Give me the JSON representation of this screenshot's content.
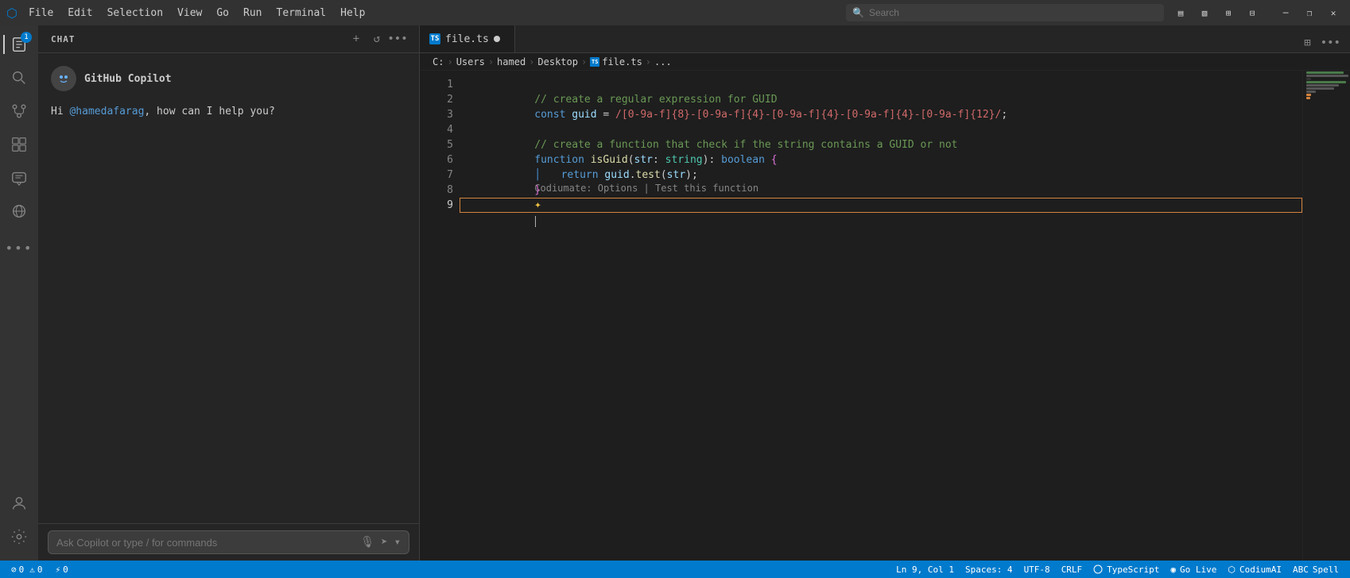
{
  "titleBar": {
    "appIcon": "⬡",
    "menuItems": [
      "File",
      "Edit",
      "Selection",
      "View",
      "Go",
      "Run",
      "Terminal",
      "Help"
    ],
    "searchPlaceholder": "Search",
    "navBack": "←",
    "navForward": "→",
    "winMinimize": "─",
    "winMaximize": "□",
    "winRestore": "❐",
    "winClose": "✕",
    "layoutBtn1": "▤",
    "layoutBtn2": "▧",
    "layoutBtn3": "⊞",
    "layoutBtn4": "⊟"
  },
  "activityBar": {
    "icons": [
      {
        "name": "vscode-icon",
        "symbol": "⬡",
        "badge": "1",
        "active": true
      },
      {
        "name": "search-icon",
        "symbol": "🔍",
        "badge": null,
        "active": false
      },
      {
        "name": "source-control-icon",
        "symbol": "⑂",
        "badge": null,
        "active": false
      },
      {
        "name": "extensions-icon",
        "symbol": "⊞",
        "badge": null,
        "active": false
      },
      {
        "name": "copilot-chat-icon",
        "symbol": "💬",
        "badge": null,
        "active": false
      },
      {
        "name": "remote-icon",
        "symbol": "◎",
        "badge": null,
        "active": false
      }
    ],
    "bottomIcons": [
      {
        "name": "account-icon",
        "symbol": "👤"
      },
      {
        "name": "settings-icon",
        "symbol": "⚙"
      }
    ]
  },
  "sidebar": {
    "title": "CHAT",
    "actions": {
      "newChat": "+",
      "history": "↺",
      "more": "•••"
    },
    "copilot": {
      "name": "GitHub Copilot",
      "avatarSymbol": "⊙"
    },
    "message": "Hi ",
    "username": "@hamedafarag",
    "messageSuffix": ", how can I help you?",
    "inputPlaceholder": "Ask Copilot or type / for commands"
  },
  "tabBar": {
    "tabs": [
      {
        "label": "file.ts",
        "icon": "TS",
        "modified": true,
        "active": true
      }
    ],
    "splitBtn": "⊞",
    "moreBtn": "•••"
  },
  "breadcrumb": {
    "items": [
      "C:",
      "Users",
      "hamed",
      "Desktop",
      "file.ts",
      "..."
    ],
    "fileIcon": "TS"
  },
  "codeEditor": {
    "lines": [
      {
        "num": 1,
        "content": "comment",
        "text": "// create a regular expression for GUID"
      },
      {
        "num": 2,
        "content": "const_line",
        "text": "const guid = /[0-9a-f]{8}-[0-9a-f]{4}-[0-9a-f]{4}-[0-9a-f]{4}-[0-9a-f]{12}/;"
      },
      {
        "num": 3,
        "content": "empty",
        "text": ""
      },
      {
        "num": 4,
        "content": "comment_hint",
        "text": "// create a function that check if the string contains a GUID or not",
        "hint": "Codiumate: Options | Test this function"
      },
      {
        "num": 5,
        "content": "function_line",
        "text": "function isGuid(str: string): boolean {"
      },
      {
        "num": 6,
        "content": "return_line",
        "text": "    return guid.test(str);",
        "vertline": true
      },
      {
        "num": 7,
        "content": "close_brace",
        "text": "}"
      },
      {
        "num": 8,
        "content": "sparkle_line",
        "text": ""
      },
      {
        "num": 9,
        "content": "empty_active",
        "text": ""
      }
    ]
  },
  "statusBar": {
    "error": "⊘ 0",
    "warning": "⚠ 0",
    "remote": "⚡ 0",
    "position": "Ln 9, Col 1",
    "spaces": "Spaces: 4",
    "encoding": "UTF-8",
    "lineEnding": "CRLF",
    "language": "TypeScript",
    "goLive": "Go Live",
    "codiumai": "CodiumAI",
    "spellcheck": "Spell"
  }
}
